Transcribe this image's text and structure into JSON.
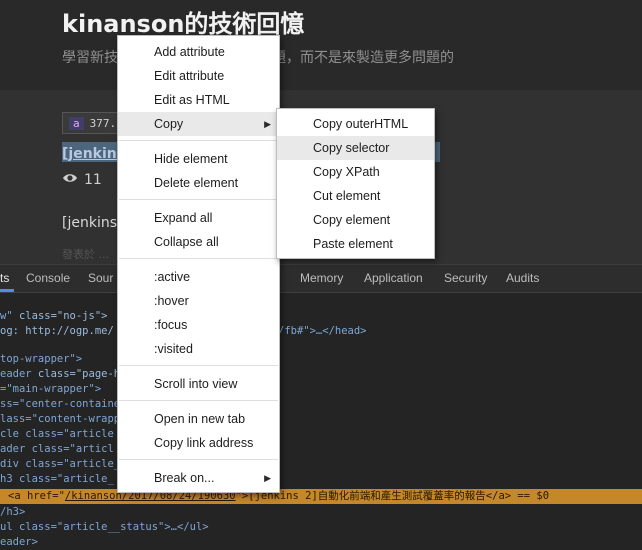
{
  "page": {
    "title": "kinanson的技術回憶",
    "subtitle": "學習新技術是為了更簡單的解決問題，而不是來製造更多問題的",
    "tooltip_tag": "a",
    "tooltip_size": "377.",
    "article_title": "[jenkins 2]自動化前端和產生測試覆蓋率的報告",
    "view_count": "11",
    "article_lead": "[jenkins",
    "faded_text": "發表於 ..."
  },
  "devtools": {
    "tabs": [
      "ts",
      "Console",
      "Sour",
      "Memory",
      "Application",
      "Security",
      "Audits"
    ],
    "active_tab": "ts",
    "tree": [
      {
        "pre": "",
        "tag": "w\"",
        "rest": " class=\"no-js\">"
      },
      {
        "pre": "",
        "tag": "og: http://ogp.me/",
        "rest": "",
        "after": "/fb#\">…</head>"
      },
      {
        "pre": "",
        "tag": "",
        "rest": ""
      },
      {
        "pre": "",
        "tag": "top-wrapper\">",
        "rest": ""
      },
      {
        "pre": "",
        "tag": "eader",
        "rest": " class=\"page-header\">"
      },
      {
        "pre": "",
        "tag": "=\"main-wrapper\">",
        "rest": ""
      },
      {
        "pre": "",
        "tag": "ss=\"center-containe",
        "rest": ""
      },
      {
        "pre": "",
        "tag": "lass=\"content-wrapp",
        "rest": ""
      },
      {
        "pre": "",
        "tag": "cle class=\"article",
        "rest": ""
      },
      {
        "pre": "",
        "tag": "ader class=\"articl",
        "rest": ""
      },
      {
        "pre": "",
        "tag": "div class=\"article_",
        "rest": ""
      },
      {
        "pre": "",
        "tag": "h3 class=\"article_",
        "rest": ""
      },
      {
        "pre": "",
        "tag": "",
        "rest": ""
      },
      {
        "pre": "",
        "tag": "/h3>",
        "rest": ""
      },
      {
        "pre": "",
        "tag": "ul class=\"article__status\">…</ul>",
        "rest": ""
      },
      {
        "pre": "",
        "tag": "eader>",
        "rest": ""
      }
    ],
    "selected_line": {
      "open": "<a href=\"",
      "href": "/kinanson/2017/08/24/190630",
      "mid": "\">",
      "text": "[jenkins 2]自動化前端和產生測試覆蓋率的報告",
      "close": "</a>",
      "suffix": " == $0"
    }
  },
  "context_menu": {
    "items": [
      "Add attribute",
      "Edit attribute",
      "Edit as HTML",
      "Copy",
      "Hide element",
      "Delete element",
      "Expand all",
      "Collapse all",
      ":active",
      ":hover",
      ":focus",
      ":visited",
      "Scroll into view",
      "Open in new tab",
      "Copy link address",
      "Break on..."
    ]
  },
  "copy_submenu": {
    "items": [
      "Copy outerHTML",
      "Copy selector",
      "Copy XPath",
      "Cut element",
      "Copy element",
      "Paste element"
    ]
  },
  "colors": {
    "selected_row": "#c4872a",
    "menu_highlight": "#e9e9e9",
    "tab_underline": "#4d8fe8"
  },
  "icons": {
    "submenu_arrow": "right-triangle-icon",
    "eye": "eye-icon"
  }
}
